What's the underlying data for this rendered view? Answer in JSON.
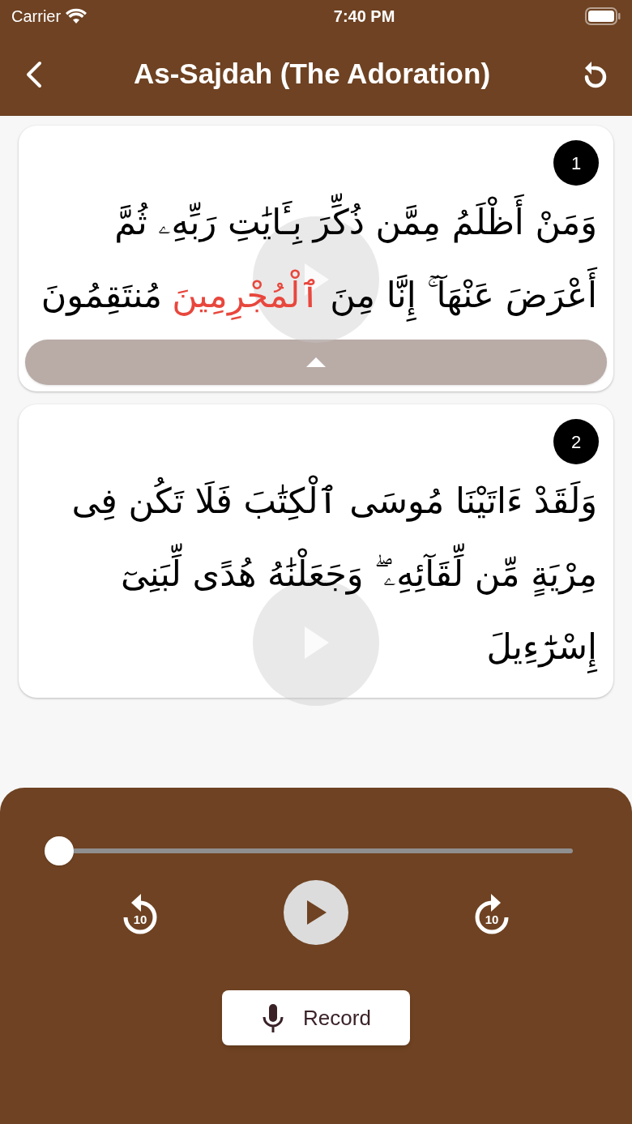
{
  "status_bar": {
    "carrier": "Carrier",
    "time": "7:40 PM"
  },
  "header": {
    "title": "As-Sajdah (The Adoration)"
  },
  "verses": [
    {
      "number": "1",
      "expanded": true,
      "lines": [
        {
          "segments": [
            {
              "text": "وَمَنْ أَظْلَمُ مِمَّن ذُكِّرَ بِـَٔايَٰتِ رَبِّهِۦ ثُمَّ",
              "highlighted": false
            }
          ]
        },
        {
          "segments": [
            {
              "text": "أَعْرَضَ عَنْهَآ ۚ إِنَّا مِنَ",
              "highlighted": false
            },
            {
              "text": "ٱلْمُجْرِمِينَ",
              "highlighted": true
            },
            {
              "text": "مُنتَقِمُونَ",
              "highlighted": false
            }
          ]
        }
      ]
    },
    {
      "number": "2",
      "expanded": false,
      "lines": [
        {
          "segments": [
            {
              "text": "وَلَقَدْ ءَاتَيْنَا مُوسَى ٱلْكِتَٰبَ فَلَا تَكُن فِى",
              "highlighted": false
            }
          ]
        },
        {
          "segments": [
            {
              "text": "مِرْيَةٍ مِّن لِّقَآئِهِۦ ۖ وَجَعَلْنَٰهُ هُدًى لِّبَنِىٓ",
              "highlighted": false
            }
          ]
        },
        {
          "segments": [
            {
              "text": "إِسْرَٰٓءِيلَ",
              "highlighted": false
            }
          ]
        }
      ]
    }
  ],
  "player": {
    "level": 0,
    "skip_back": "10",
    "skip_forward": "10",
    "record_label": "Record"
  }
}
